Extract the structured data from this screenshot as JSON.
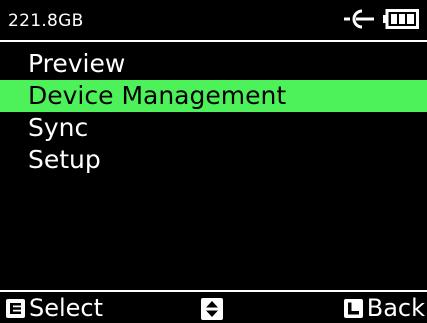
{
  "status": {
    "storage_free": "221.8GB",
    "connection_icon": "connector-plug-icon",
    "battery_icon": "battery-full-icon"
  },
  "menu": {
    "items": [
      {
        "label": "Preview",
        "selected": false
      },
      {
        "label": "Device Management",
        "selected": true
      },
      {
        "label": "Sync",
        "selected": false
      },
      {
        "label": "Setup",
        "selected": false
      }
    ],
    "highlight_color": "#4df25a"
  },
  "softkeys": {
    "left_label": "Select",
    "left_key_icon": "key-e-icon",
    "center_icon": "up-down-arrows-icon",
    "right_label": "Back",
    "right_key_icon": "key-l-icon"
  }
}
